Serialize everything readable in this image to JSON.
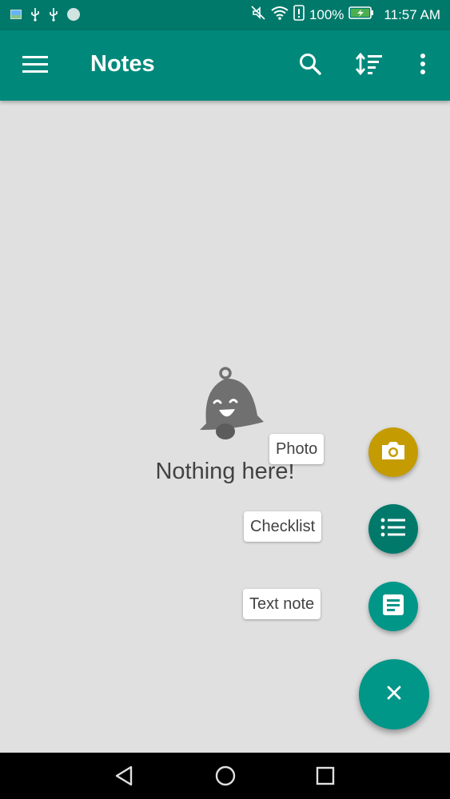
{
  "status_bar": {
    "battery": "100%",
    "time": "11:57 AM",
    "icons": [
      "gallery-notification-icon",
      "usb-icon",
      "usb-icon",
      "circle-notification-icon",
      "mute-icon",
      "wifi-icon",
      "signal-alert-icon",
      "battery-charging-icon"
    ]
  },
  "app_bar": {
    "title": "Notes",
    "icons": [
      "menu-icon",
      "search-icon",
      "sort-icon",
      "more-vert-icon"
    ]
  },
  "empty_state": {
    "message": "Nothing here!",
    "icon": "bell-smile-icon"
  },
  "fab_menu": {
    "items": [
      {
        "label": "Photo",
        "icon": "camera-icon",
        "color": "#c49b00"
      },
      {
        "label": "Checklist",
        "icon": "list-icon",
        "color": "#00796b"
      },
      {
        "label": "Text note",
        "icon": "note-icon",
        "color": "#009688"
      }
    ],
    "main_icon": "close-icon",
    "main_color": "#009688"
  },
  "colors": {
    "primary": "#00897b",
    "primary_dark": "#00796b",
    "background": "#e0e0e0"
  },
  "nav_bar": {
    "icons": [
      "back-icon",
      "home-icon",
      "recents-icon"
    ]
  }
}
